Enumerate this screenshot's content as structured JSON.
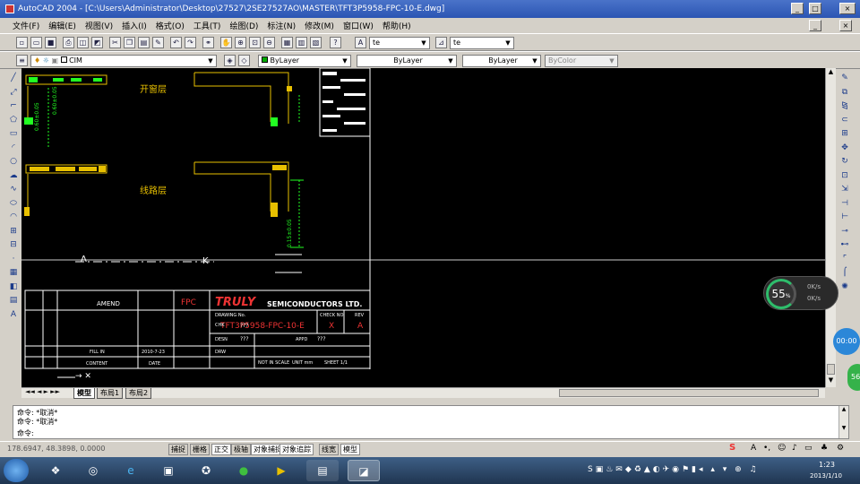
{
  "window": {
    "title": "AutoCAD 2004 - [C:\\Users\\Administrator\\Desktop\\27527\\2SE27527AO\\MASTER\\TFT3P5958-FPC-10-E.dwg]",
    "min": "_",
    "max": "□",
    "close": "×"
  },
  "menu": [
    "文件(F)",
    "编辑(E)",
    "视图(V)",
    "插入(I)",
    "格式(O)",
    "工具(T)",
    "绘图(D)",
    "标注(N)",
    "修改(M)",
    "窗口(W)",
    "帮助(H)"
  ],
  "toolbar": {
    "text_style": "te",
    "dim_style": "te",
    "layer": "CIM",
    "color": "ByLayer",
    "linetype": "ByLayer",
    "lineweight": "ByLayer",
    "plotstyle": "ByColor"
  },
  "drawing": {
    "label_top": "开窗层",
    "label_bottom": "线路层",
    "dim_v1": "0.60±0.05",
    "dim_v2": "0.60±0.05",
    "dim_v3": "0.15±0.05",
    "section_a": "A",
    "section_k": "K",
    "titleblock": {
      "amend": "AMEND",
      "fpc": "FPC",
      "company_logo": "TRULY",
      "company": "SEMICONDUCTORS LTD.",
      "drawing_no_label": "DRAWING No.",
      "drawing_no": "TFT3P5958-FPC-10-E",
      "check_label": "CHECK NO.",
      "rev_label": "REV",
      "rev": "A",
      "x_val": "X",
      "design_label": "DESN",
      "design": "???",
      "chk_label": "CHK",
      "chk": "???",
      "appd_label": "APPD",
      "appd": "???",
      "draw_label": "DRW",
      "scale": "NOT IN SCALE",
      "unit": "UNIT mm",
      "sheet": "SHEET 1/1",
      "fill": "FILL IN",
      "date_val": "2010-7-23",
      "content": "CONTENT",
      "date": "DATE"
    }
  },
  "tabs": [
    "模型",
    "布局1",
    "布局2"
  ],
  "command": {
    "line1": "命令: *取消*",
    "line2": "命令: *取消*",
    "prompt": "命令:"
  },
  "status": {
    "coords": "178.6947, 48.3898, 0.0000",
    "buttons": [
      "捕捉",
      "栅格",
      "正交",
      "极轴",
      "对象捕捉",
      "对象追踪",
      "线宽",
      "模型"
    ]
  },
  "overlay": {
    "speed_pct": "55",
    "speed_unit": "%",
    "net1": "0K/s",
    "net2": "0K/s",
    "timer": "00:00",
    "badge": "56"
  },
  "taskbar": {
    "time": "1:23",
    "date": "2013/1/10"
  }
}
